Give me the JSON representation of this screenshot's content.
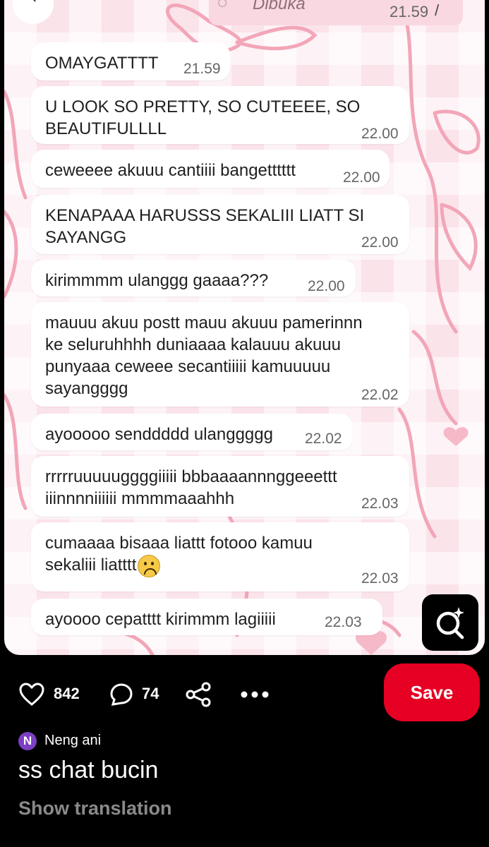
{
  "chat": {
    "status": {
      "text": "Dibuka",
      "time": "21.59"
    },
    "messages": [
      {
        "text": "OMAYGATTTT",
        "time": "21.59"
      },
      {
        "text": "U LOOK SO PRETTY, SO CUTEEEE, SO\nBEAUTIFULLLL",
        "time": "22.00"
      },
      {
        "text": "ceweeee akuuu cantiiii bangetttttt",
        "time": "22.00"
      },
      {
        "text": "KENAPAAA HARUSSS SEKALIII LIATT SI\nSAYANGG",
        "time": "22.00"
      },
      {
        "text": "kirimmmm ulanggg gaaaa???",
        "time": "22.00"
      },
      {
        "text": "mauuu akuu postt mauu akuuu pamerinnn\nke seluruhhhh duniaaaa kalauuu akuuu\npunyaaa ceweee secantiiiii kamuuuuu\nsayangggg",
        "time": "22.02"
      },
      {
        "text": "ayooooo senddddd ulanggggg",
        "time": "22.02"
      },
      {
        "text": "rrrrruuuuuggggiiiii bbbaaaannnggeeettt\niiinnnniiiiii mmmmaaahhh",
        "time": "22.03"
      },
      {
        "text": "cumaaaa bisaaa liattt fotooo kamuu\nsekaliii liatttt",
        "time": "22.03"
      },
      {
        "text": "ayoooo cepatttt kirimmm lagiiiii",
        "time": "22.03"
      }
    ]
  },
  "actions": {
    "likes": "842",
    "comments": "74",
    "save_label": "Save"
  },
  "pin": {
    "author_initial": "N",
    "author_name": "Neng ani",
    "title": "ss chat bucin",
    "translate_label": "Show translation"
  },
  "colors": {
    "save": "#e60023",
    "avatar": "#7c3fc4",
    "chat_background": "#fbe3ea"
  },
  "icons": [
    "back-arrow-icon",
    "clock-icon",
    "double-check-icon",
    "frowning-face-emoji",
    "visual-search-icon",
    "heart-icon",
    "comment-icon",
    "share-icon",
    "more-icon"
  ]
}
